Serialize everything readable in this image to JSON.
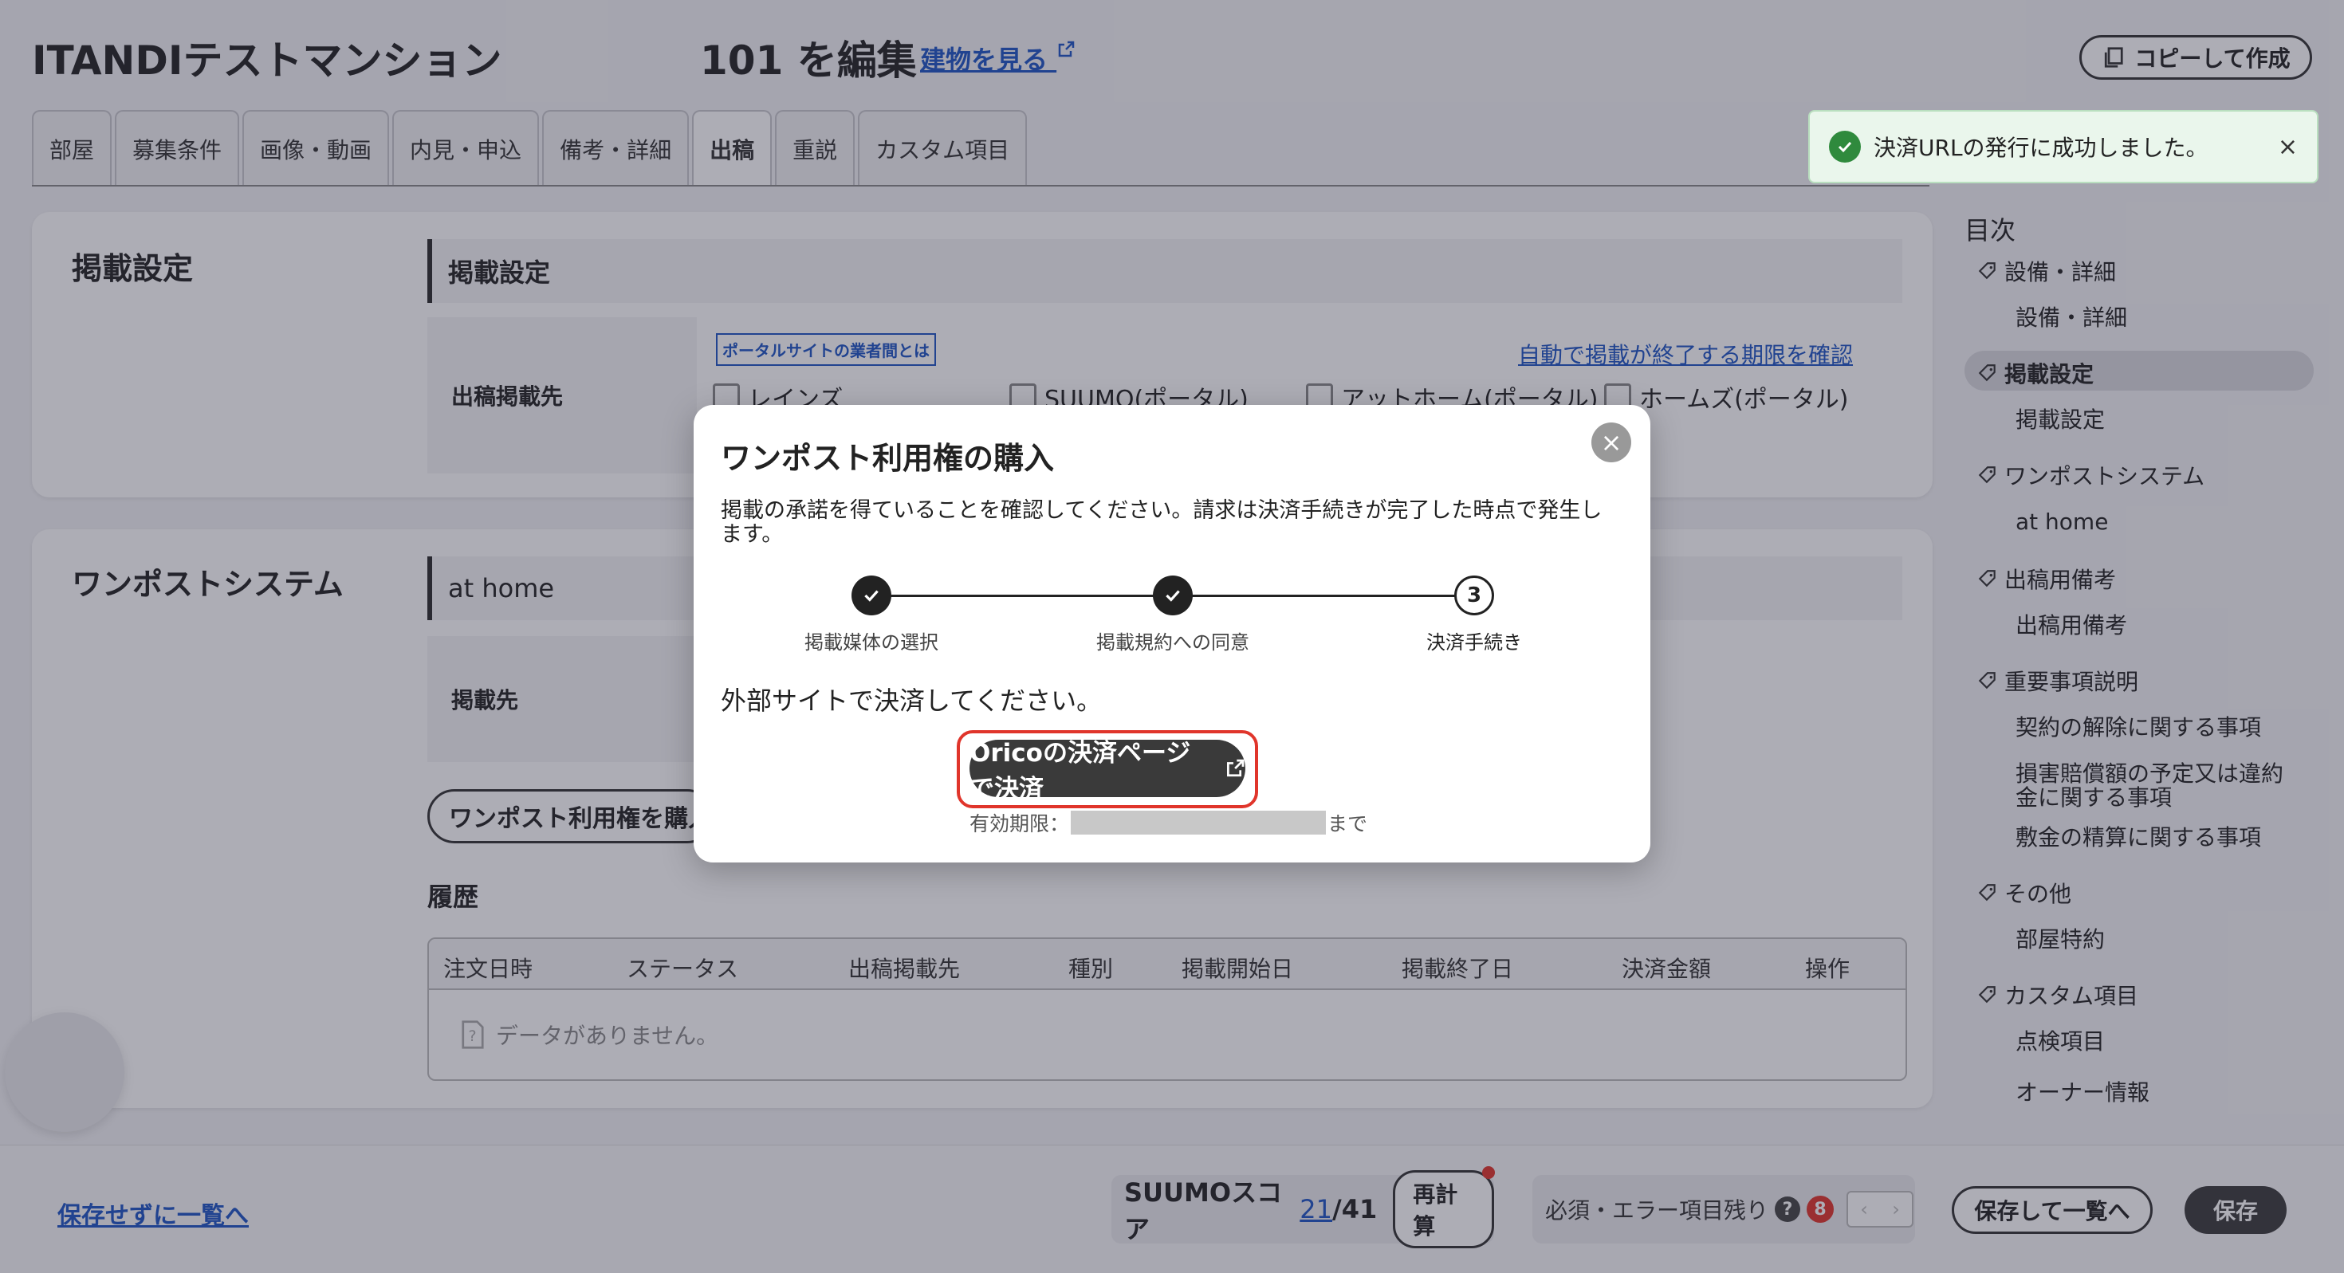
{
  "header": {
    "building_name": "ITANDIテストマンション",
    "room_title": "101 を編集",
    "view_building_link": "建物を見る",
    "copy_button": "コピーして作成"
  },
  "tabs": [
    {
      "label": "部屋"
    },
    {
      "label": "募集条件"
    },
    {
      "label": "画像・動画"
    },
    {
      "label": "内見・申込"
    },
    {
      "label": "備考・詳細"
    },
    {
      "label": "出稿",
      "active": true
    },
    {
      "label": "重説"
    },
    {
      "label": "カスタム項目"
    }
  ],
  "toast": {
    "message": "決済URLの発行に成功しました。",
    "close": "×",
    "color": "#2f8a3d"
  },
  "section_listing": {
    "title": "掲載設定",
    "subheader": "掲載設定",
    "row_label": "出稿掲載先",
    "portal_badge": "ポータルサイトの業者間とは",
    "auto_end_link": "自動で掲載が終了する期限を確認",
    "options": [
      "レインズ",
      "SUUMO(ポータル)",
      "アットホーム(ポータル)",
      "ホームズ(ポータル)"
    ]
  },
  "section_onepost": {
    "title": "ワンポストシステム",
    "subheader": "at home",
    "row_label": "掲載先",
    "buy_button": "ワンポスト利用権を購入",
    "history_label": "履歴",
    "table_headers": [
      "注文日時",
      "ステータス",
      "出稿掲載先",
      "種別",
      "掲載開始日",
      "掲載終了日",
      "決済金額",
      "操作"
    ],
    "empty_text": "データがありません。"
  },
  "toc": {
    "title": "目次",
    "items": [
      {
        "label": "設備・詳細",
        "level": 1
      },
      {
        "label": "設備・詳細",
        "level": 2
      },
      {
        "label": "掲載設定",
        "level": 1,
        "active": true
      },
      {
        "label": "掲載設定",
        "level": 2
      },
      {
        "label": "ワンポストシステム",
        "level": 1
      },
      {
        "label": "at home",
        "level": 2
      },
      {
        "label": "出稿用備考",
        "level": 1
      },
      {
        "label": "出稿用備考",
        "level": 2
      },
      {
        "label": "重要事項説明",
        "level": 1
      },
      {
        "label": "契約の解除に関する事項",
        "level": 2
      },
      {
        "label": "損害賠償額の予定又は違約金に関する事項",
        "level": 2
      },
      {
        "label": "敷金の精算に関する事項",
        "level": 2
      },
      {
        "label": "その他",
        "level": 1
      },
      {
        "label": "部屋特約",
        "level": 2
      },
      {
        "label": "カスタム項目",
        "level": 1
      },
      {
        "label": "点検項目",
        "level": 2
      },
      {
        "label": "オーナー情報",
        "level": 2
      }
    ]
  },
  "bottom": {
    "cancel_link": "保存せずに一覧へ",
    "suumo_label": "SUUMOスコア",
    "suumo_score": "21",
    "suumo_total": "/41",
    "recalc": "再計算",
    "error_label": "必須・エラー項目残り",
    "error_count": "8",
    "save_list": "保存して一覧へ",
    "save": "保存"
  },
  "modal": {
    "title": "ワンポスト利用権の購入",
    "close": "×",
    "description": "掲載の承諾を得ていることを確認してください。請求は決済手続きが完了した時点で発生します。",
    "steps": [
      {
        "label": "掲載媒体の選択",
        "state": "done"
      },
      {
        "label": "掲載規約への同意",
        "state": "done"
      },
      {
        "label": "決済手続き",
        "state": "current",
        "number": "3"
      }
    ],
    "external_text": "外部サイトで決済してください。",
    "pay_button": "Oricoの決済ページで決済",
    "expiry_prefix": "有効期限：",
    "expiry_suffix": "まで"
  },
  "colors": {
    "link": "#1d54c4",
    "highlight": "#e0352b",
    "dark_button": "#3a3a3a"
  }
}
